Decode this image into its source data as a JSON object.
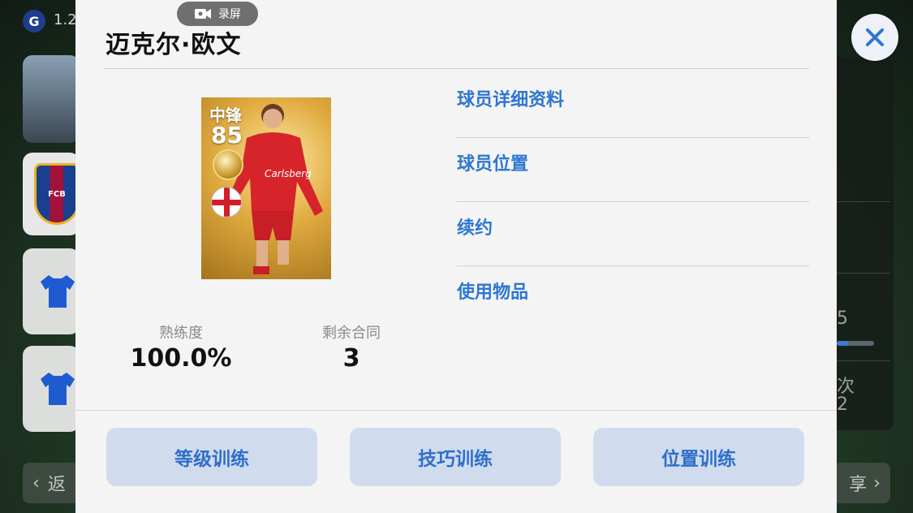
{
  "background": {
    "top_left_letter": "G",
    "top_left_text": "1.2",
    "club_label": "FCB",
    "bottom_left_text": "返",
    "bottom_right_text": "享",
    "right_fragments": [
      "5",
      "次",
      "2"
    ]
  },
  "recording_badge": {
    "label": "录屏",
    "icon": "video-camera-icon"
  },
  "player": {
    "name": "迈克尔·欧文",
    "card": {
      "position": "中锋",
      "rating": "85",
      "nation_icon": "england-flag-icon"
    }
  },
  "stats": [
    {
      "label": "熟练度",
      "value": "100.0%"
    },
    {
      "label": "剩余合同",
      "value": "3"
    }
  ],
  "menu": [
    {
      "label": "球员详细资料"
    },
    {
      "label": "球员位置"
    },
    {
      "label": "续约"
    },
    {
      "label": "使用物品"
    }
  ],
  "actions": [
    {
      "label": "等级训练"
    },
    {
      "label": "技巧训练"
    },
    {
      "label": "位置训练"
    }
  ],
  "close": {
    "icon": "close-icon"
  },
  "colors": {
    "accent": "#2f76d2",
    "button_bg": "#d0dcee",
    "modal_bg": "#f4f4f4"
  }
}
